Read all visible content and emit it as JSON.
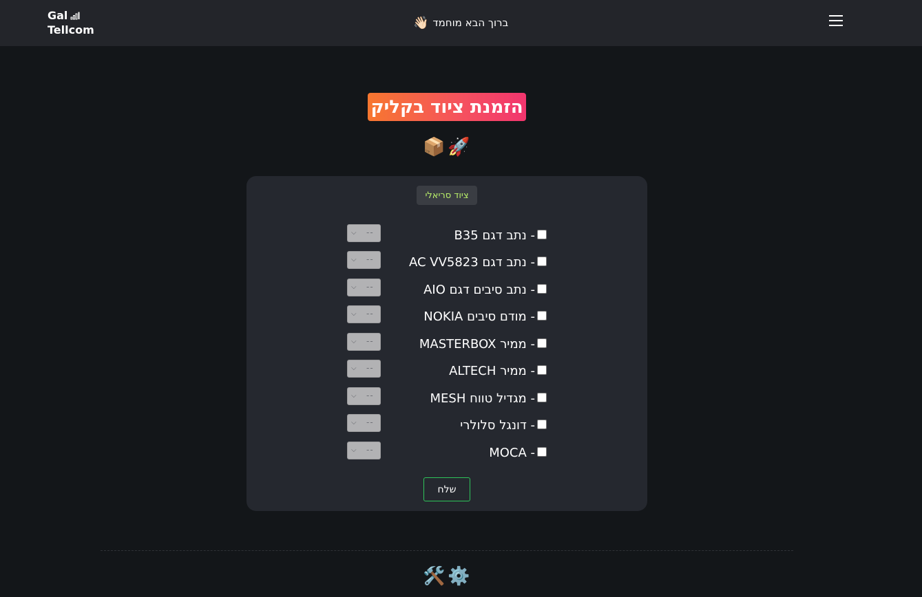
{
  "header": {
    "brand_line1": "Gal",
    "brand_line2": "Tellcom",
    "welcome_text": "ברוך הבא מוחמד",
    "welcome_emoji": "👋🏻",
    "menu_icon": "hamburger-menu-icon"
  },
  "main": {
    "title": "הזמנת ציוד בקליק",
    "title_emojis": "📦🚀",
    "card": {
      "tag": "ציוד סריאלי",
      "items": [
        {
          "label": "- נתב דגם B35",
          "select_value": "--"
        },
        {
          "label": "- נתב דגם AC VV5823",
          "select_value": "--"
        },
        {
          "label": "- נתב סיבים דגם AIO",
          "select_value": "--"
        },
        {
          "label": "- מודם סיבים NOKIA",
          "select_value": "--"
        },
        {
          "label": "- ממיר MASTERBOX",
          "select_value": "--"
        },
        {
          "label": "- ממיר ALTECH",
          "select_value": "--"
        },
        {
          "label": "- מגדיל טווח MESH",
          "select_value": "--"
        },
        {
          "label": "- דונגל סלולרי",
          "select_value": "--"
        },
        {
          "label": "- MOCA",
          "select_value": "--"
        }
      ],
      "submit_label": "שלח"
    }
  },
  "footer": {
    "icons": "🛠️⚙️"
  },
  "colors": {
    "page_bg": "#131619",
    "navbar_bg": "#23252a",
    "card_bg": "#25282f",
    "tag_text": "#b9ef6a",
    "submit_border": "#2fc55a",
    "title_gradient_start": "#f7772f",
    "title_gradient_end": "#f2356e"
  }
}
